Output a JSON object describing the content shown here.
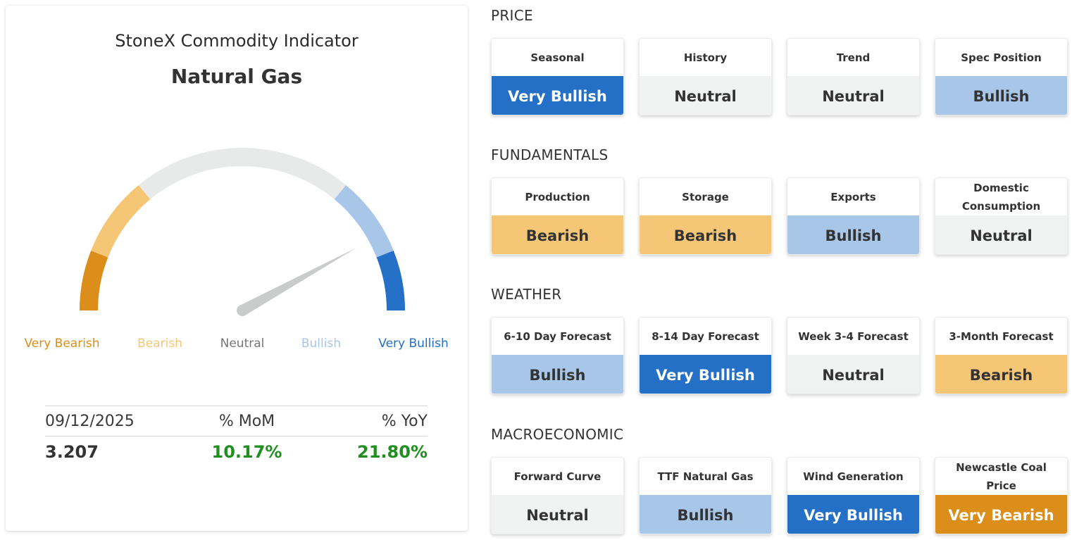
{
  "indicator": {
    "title": "StoneX Commodity Indicator",
    "commodity": "Natural Gas",
    "gauge": {
      "needle_value": 0.84,
      "labels": [
        "Very Bearish",
        "Bearish",
        "Neutral",
        "Bullish",
        "Very Bullish"
      ],
      "colors": {
        "very_bearish": "#db8e1a",
        "bearish": "#f6c677",
        "neutral": "#e8e9e9",
        "bullish": "#a7c6e8",
        "very_bullish": "#2470c7",
        "needle": "#c9cccb"
      }
    },
    "stats": {
      "date": "09/12/2025",
      "mom_header": "% MoM",
      "yoy_header": "% YoY",
      "price": "3.207",
      "mom_value": "10.17%",
      "yoy_value": "21.80%"
    }
  },
  "sections": [
    {
      "heading": "PRICE",
      "tiles": [
        {
          "name": "Seasonal",
          "value": "Very Bullish"
        },
        {
          "name": "History",
          "value": "Neutral"
        },
        {
          "name": "Trend",
          "value": "Neutral"
        },
        {
          "name": "Spec Position",
          "value": "Bullish"
        }
      ]
    },
    {
      "heading": "FUNDAMENTALS",
      "tiles": [
        {
          "name": "Production",
          "value": "Bearish"
        },
        {
          "name": "Storage",
          "value": "Bearish"
        },
        {
          "name": "Exports",
          "value": "Bullish"
        },
        {
          "name": "Domestic Consumption",
          "value": "Neutral"
        }
      ]
    },
    {
      "heading": "WEATHER",
      "tiles": [
        {
          "name": "6-10 Day Forecast",
          "value": "Bullish"
        },
        {
          "name": "8-14 Day Forecast",
          "value": "Very Bullish"
        },
        {
          "name": "Week 3-4 Forecast",
          "value": "Neutral"
        },
        {
          "name": "3-Month Forecast",
          "value": "Bearish"
        }
      ]
    },
    {
      "heading": "MACROECONOMIC",
      "tiles": [
        {
          "name": "Forward Curve",
          "value": "Neutral"
        },
        {
          "name": "TTF Natural Gas",
          "value": "Bullish"
        },
        {
          "name": "Wind Generation",
          "value": "Very Bullish"
        },
        {
          "name": "Newcastle Coal Price",
          "value": "Very Bearish"
        }
      ]
    }
  ]
}
